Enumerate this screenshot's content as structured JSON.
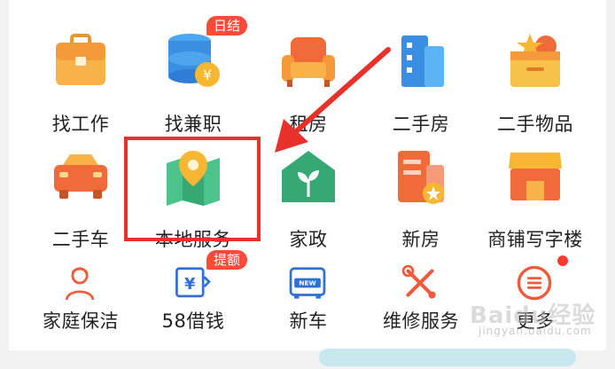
{
  "grid": {
    "row1": [
      {
        "label": "找工作"
      },
      {
        "label": "找兼职",
        "badge": "日结"
      },
      {
        "label": "租房"
      },
      {
        "label": "二手房"
      },
      {
        "label": "二手物品"
      }
    ],
    "row2": [
      {
        "label": "二手车"
      },
      {
        "label": "本地服务"
      },
      {
        "label": "家政"
      },
      {
        "label": "新房"
      },
      {
        "label": "商铺写字楼"
      }
    ],
    "row3": [
      {
        "label": "家庭保洁"
      },
      {
        "label": "58借钱",
        "badge": "提额"
      },
      {
        "label": "新车"
      },
      {
        "label": "维修服务"
      },
      {
        "label": "更多"
      }
    ]
  },
  "watermark": {
    "text": "Baidu经验",
    "sub": "jingyan.baidu.com"
  },
  "colors": {
    "highlight": "#e8312a",
    "badge": "#ff4a3a"
  }
}
